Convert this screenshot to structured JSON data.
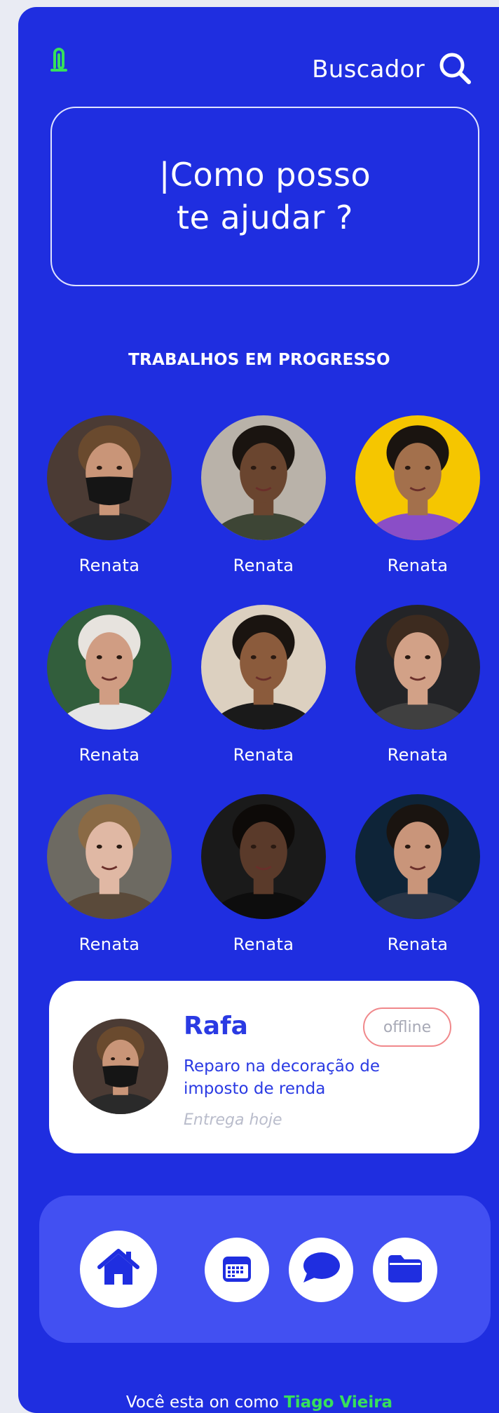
{
  "header": {
    "search_label": "Buscador",
    "logo_icon": "paperclip-logo",
    "search_icon": "search-icon"
  },
  "hero": {
    "text": "|Como posso\nte ajudar ?"
  },
  "section": {
    "title": "TRABALHOS EM PROGRESSO"
  },
  "people": [
    {
      "name": "Renata",
      "skin": "#c99578",
      "hair": "#6a4a2e",
      "bg": "#4b3b34",
      "shirt": "#2a2a2a",
      "mask": true
    },
    {
      "name": "Renata",
      "skin": "#6a452f",
      "hair": "#1a1410",
      "bg": "#b9b2a9",
      "shirt": "#3d4535"
    },
    {
      "name": "Renata",
      "skin": "#a3704c",
      "hair": "#1a1410",
      "bg": "#f5c600",
      "shirt": "#8a4ec7"
    },
    {
      "name": "Renata",
      "skin": "#d09d83",
      "hair": "#e7e3de",
      "bg": "#325e3c",
      "shirt": "#e5e5e5"
    },
    {
      "name": "Renata",
      "skin": "#8b5b3c",
      "hair": "#1a1410",
      "bg": "#dcd0c0",
      "shirt": "#1a1a1a"
    },
    {
      "name": "Renata",
      "skin": "#d2a187",
      "hair": "#3d2b1f",
      "bg": "#232427",
      "shirt": "#404040"
    },
    {
      "name": "Renata",
      "skin": "#e0b8a4",
      "hair": "#8a6a45",
      "bg": "#6d6a62",
      "shirt": "#5a4a3a"
    },
    {
      "name": "Renata",
      "skin": "#5a3a2a",
      "hair": "#0d0a08",
      "bg": "#1a1a1a",
      "shirt": "#0d0d0d"
    },
    {
      "name": "Renata",
      "skin": "#c9957a",
      "hair": "#1a1410",
      "bg": "#0e2438",
      "shirt": "#273446"
    }
  ],
  "task_card": {
    "name": "Rafa",
    "status": "offline",
    "description": "Reparo na decoração de imposto de renda",
    "due": "Entrega hoje"
  },
  "nav": {
    "items": [
      "home-icon",
      "calendar-icon",
      "chat-icon",
      "folder-icon"
    ]
  },
  "footer": {
    "prefix": "Você esta on como ",
    "user": "Tiago Vieira"
  },
  "colors": {
    "background": "#1f2ee0",
    "accent_green": "#37e05b",
    "card_text": "#2a3ae3",
    "badge_border": "#f0888b"
  }
}
